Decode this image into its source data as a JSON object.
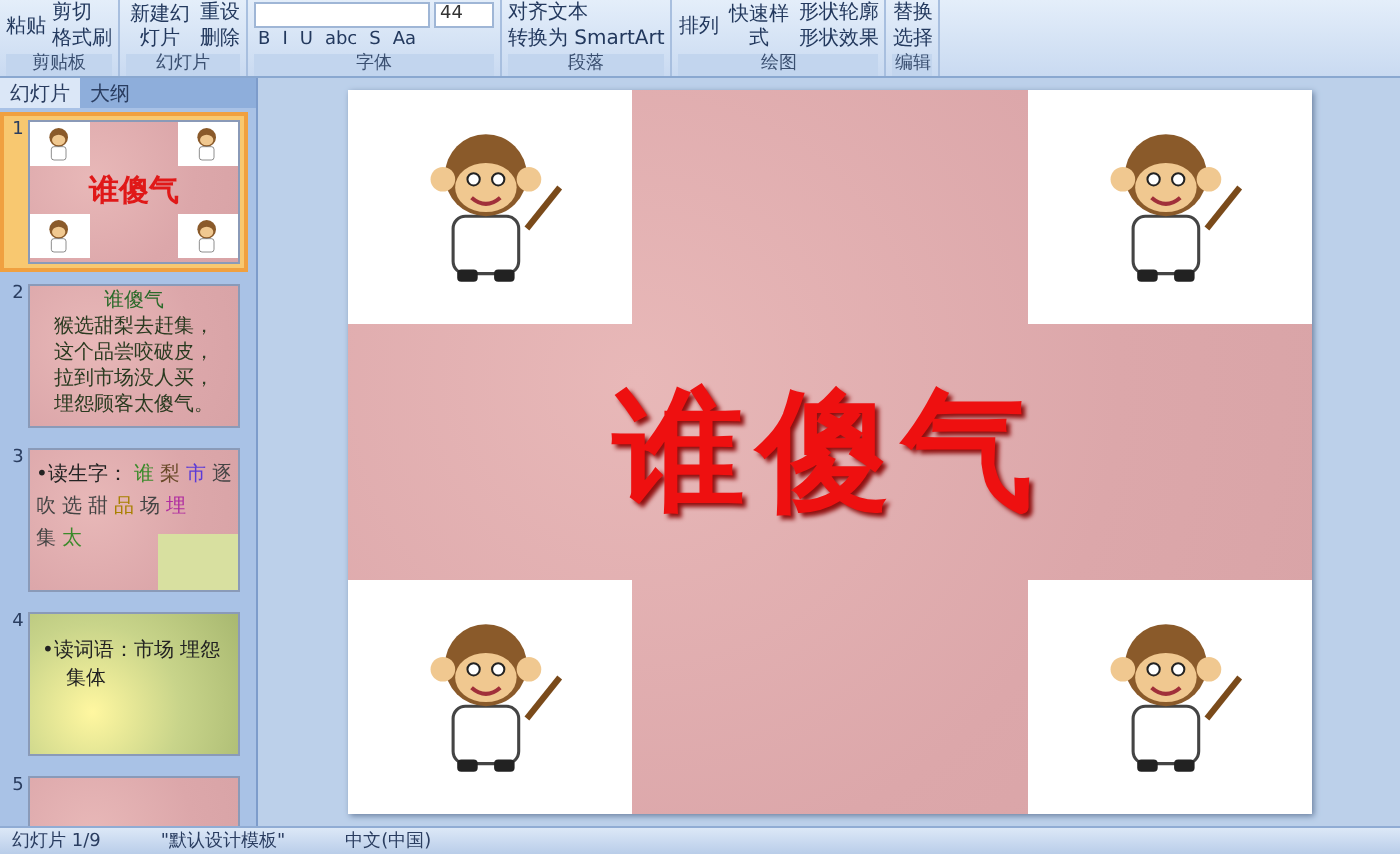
{
  "ribbon": {
    "groups": [
      {
        "label": "剪贴板",
        "big": "粘贴",
        "small": [
          "剪切",
          "格式刷"
        ]
      },
      {
        "label": "幻灯片",
        "big": "新建幻灯片",
        "small": [
          "重设",
          "删除"
        ]
      },
      {
        "label": "字体",
        "font_size": "44",
        "format_buttons": [
          "B",
          "I",
          "U",
          "abc",
          "S",
          "Aa"
        ]
      },
      {
        "label": "段落",
        "small": [
          "对齐文本",
          "转换为 SmartArt"
        ]
      },
      {
        "label": "绘图",
        "big": "排列",
        "big2": "快速样式",
        "small": [
          "形状轮廓",
          "形状效果"
        ]
      },
      {
        "label": "编辑",
        "small": [
          "替换",
          "选择"
        ]
      }
    ]
  },
  "panel": {
    "tabs": [
      {
        "label": "幻灯片",
        "selected": true
      },
      {
        "label": "大纲",
        "selected": false
      }
    ],
    "slides": [
      {
        "number": "1",
        "selected": true,
        "kind": "title",
        "title": "谁傻气"
      },
      {
        "number": "2",
        "selected": false,
        "kind": "poem",
        "title": "谁傻气",
        "lines": [
          "猴选甜梨去赶集，",
          "这个品尝咬破皮，",
          "拉到市场没人买，",
          "埋怨顾客太傻气。"
        ]
      },
      {
        "number": "3",
        "selected": false,
        "kind": "chars",
        "lines": [
          [
            {
              "text": "•读生字：",
              "color": "#222222"
            },
            {
              "text": "谁",
              "color": "#3a8a2a"
            },
            {
              "text": "梨",
              "color": "#6a4a2a"
            },
            {
              "text": "市",
              "color": "#5a3ad8"
            },
            {
              "text": "逐",
              "color": "#444444"
            }
          ],
          [
            {
              "text": "吹",
              "color": "#444444"
            },
            {
              "text": "选",
              "color": "#444444"
            },
            {
              "text": "甜",
              "color": "#444444"
            },
            {
              "text": "品",
              "color": "#a88000"
            },
            {
              "text": "场",
              "color": "#444444"
            },
            {
              "text": "埋",
              "color": "#b02ca0"
            }
          ],
          [
            {
              "text": "集",
              "color": "#444444"
            },
            {
              "text": "太",
              "color": "#3a8a2a"
            }
          ]
        ]
      },
      {
        "number": "4",
        "selected": false,
        "kind": "words",
        "lines": [
          "•读词语：市场 埋怨",
          "集体"
        ]
      },
      {
        "number": "5",
        "selected": false,
        "kind": "blank"
      }
    ]
  },
  "slide": {
    "title": "谁傻气"
  },
  "status_bar": [
    "幻灯片 1/9",
    "\"默认设计模板\"",
    "中文(中国)"
  ]
}
